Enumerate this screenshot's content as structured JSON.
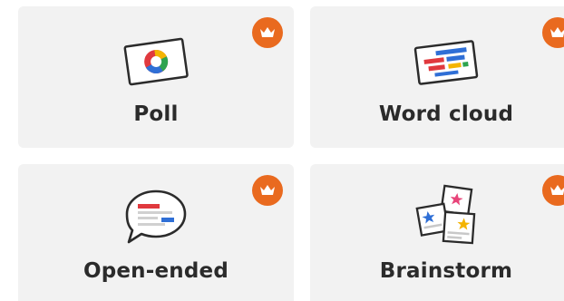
{
  "cards": [
    {
      "id": "poll",
      "label": "Poll",
      "premium": true,
      "icon": "poll-icon"
    },
    {
      "id": "word-cloud",
      "label": "Word cloud",
      "premium": true,
      "icon": "word-cloud-icon"
    },
    {
      "id": "open-ended",
      "label": "Open-ended",
      "premium": true,
      "icon": "open-ended-icon"
    },
    {
      "id": "brainstorm",
      "label": "Brainstorm",
      "premium": true,
      "icon": "brainstorm-icon"
    }
  ],
  "colors": {
    "card_bg": "#f2f2f2",
    "premium_badge": "#e96a1f",
    "label_text": "#2b2b2b",
    "red": "#e0393e",
    "blue": "#2f6fd6",
    "yellow": "#f4b400",
    "green": "#2ea44f",
    "pink": "#e8457a"
  }
}
